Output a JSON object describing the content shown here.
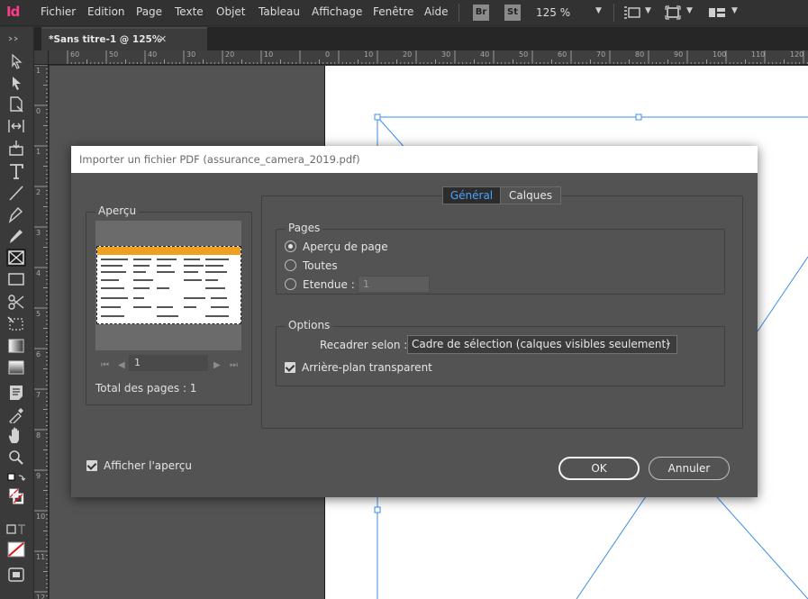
{
  "app": {
    "logo": "Id",
    "zoom": "125 %",
    "bridge_badge": "Br",
    "stock_badge": "St"
  },
  "menu": [
    "Fichier",
    "Edition",
    "Page",
    "Texte",
    "Objet",
    "Tableau",
    "Affichage",
    "Fenêtre",
    "Aide"
  ],
  "document_tab": {
    "title": "*Sans titre-1 @ 125%",
    "close": "✕"
  },
  "rulers": {
    "horizontal": [
      "60",
      "50",
      "40",
      "30",
      "20",
      "10",
      "0",
      "10",
      "20",
      "30",
      "40",
      "50",
      "60",
      "70",
      "80",
      "90",
      "100",
      "110",
      "120"
    ],
    "vertical": [
      "1",
      "0",
      "1",
      "2",
      "3",
      "4",
      "5",
      "6",
      "7",
      "8",
      "9",
      "10",
      "11",
      "12"
    ]
  },
  "dialog": {
    "title": "Importer un fichier PDF (assurance_camera_2019.pdf)",
    "preview": {
      "legend": "Aperçu",
      "page_number": "1",
      "total_pages": "Total des pages : 1"
    },
    "tabs": {
      "general": "Général",
      "layers": "Calques"
    },
    "pages": {
      "legend": "Pages",
      "options": [
        "Aperçu de page",
        "Toutes",
        "Etendue :"
      ],
      "selected_index": 0,
      "range_value": "1"
    },
    "options": {
      "legend": "Options",
      "crop_label": "Recadrer selon :",
      "crop_value": "Cadre de sélection (calques visibles seulement)",
      "transparent_bg": "Arrière-plan transparent",
      "transparent_bg_checked": true
    },
    "show_preview": "Afficher l'aperçu",
    "show_preview_checked": true,
    "ok": "OK",
    "cancel": "Annuler"
  },
  "colors": {
    "accent_tab": "#4aa3ff",
    "app_logo": "#ff3a8a",
    "frame_stroke": "#3b8ee8",
    "thumb_header": "#f0a020"
  }
}
